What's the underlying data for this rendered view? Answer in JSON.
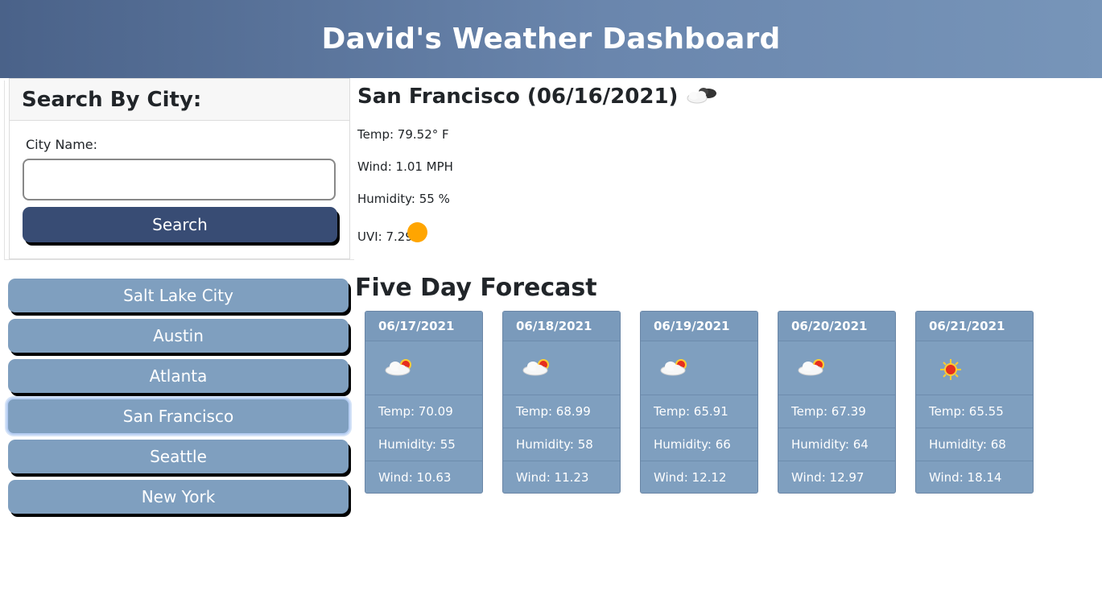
{
  "header": {
    "title": "David's Weather Dashboard"
  },
  "search": {
    "heading": "Search By City:",
    "label": "City Name:",
    "input_value": "",
    "button_label": "Search"
  },
  "history": [
    {
      "label": "Salt Lake City",
      "active": false
    },
    {
      "label": "Austin",
      "active": false
    },
    {
      "label": "Atlanta",
      "active": false
    },
    {
      "label": "San Francisco",
      "active": true
    },
    {
      "label": "Seattle",
      "active": false
    },
    {
      "label": "New York",
      "active": false
    }
  ],
  "current": {
    "title": "San Francisco (06/16/2021)",
    "icon": "partly-cloudy-night-icon",
    "temp": "Temp: 79.52° F",
    "wind": "Wind: 1.01 MPH",
    "humidity": "Humidity: 55 %",
    "uvi": "UVI: 7.29",
    "uvi_color": "#ffa500"
  },
  "forecast": {
    "title": "Five Day Forecast",
    "days": [
      {
        "date": "06/17/2021",
        "icon": "partly-cloudy-icon",
        "temp": "Temp: 70.09",
        "humidity": "Humidity: 55",
        "wind": "Wind: 10.63"
      },
      {
        "date": "06/18/2021",
        "icon": "partly-cloudy-icon",
        "temp": "Temp: 68.99",
        "humidity": "Humidity: 58",
        "wind": "Wind: 11.23"
      },
      {
        "date": "06/19/2021",
        "icon": "partly-cloudy-icon",
        "temp": "Temp: 65.91",
        "humidity": "Humidity: 66",
        "wind": "Wind: 12.12"
      },
      {
        "date": "06/20/2021",
        "icon": "partly-cloudy-icon",
        "temp": "Temp: 67.39",
        "humidity": "Humidity: 64",
        "wind": "Wind: 12.97"
      },
      {
        "date": "06/21/2021",
        "icon": "sun-icon",
        "temp": "Temp: 65.55",
        "humidity": "Humidity: 68",
        "wind": "Wind: 18.14"
      }
    ]
  },
  "colors": {
    "header_start": "#4a6289",
    "header_end": "#7795b9",
    "search_button": "#384c74",
    "city_button": "#7f9fbf",
    "card": "#7f9fbf"
  }
}
